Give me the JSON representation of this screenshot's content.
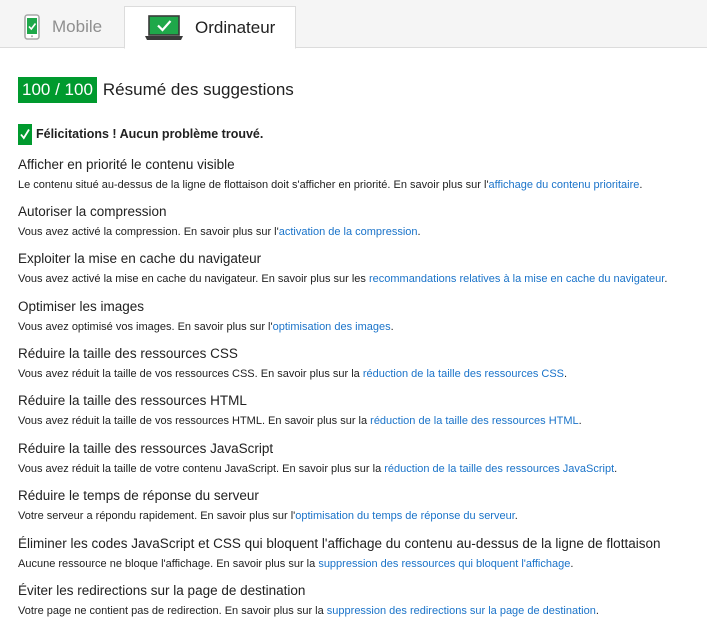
{
  "tabs": [
    {
      "label": "Mobile",
      "icon": "smartphone-icon",
      "active": false
    },
    {
      "label": "Ordinateur",
      "icon": "laptop-icon",
      "active": true
    }
  ],
  "score": {
    "value": "100 / 100",
    "title": "Résumé des suggestions"
  },
  "congrats": "Félicitations ! Aucun problème trouvé.",
  "rules": [
    {
      "title": "Afficher en priorité le contenu visible",
      "pre": "Le contenu situé au-dessus de la ligne de flottaison doit s'afficher en priorité. En savoir plus sur l'",
      "link": "affichage du contenu prioritaire",
      "post": "."
    },
    {
      "title": "Autoriser la compression",
      "pre": "Vous avez activé la compression. En savoir plus sur l'",
      "link": "activation de la compression",
      "post": "."
    },
    {
      "title": "Exploiter la mise en cache du navigateur",
      "pre": "Vous avez activé la mise en cache du navigateur. En savoir plus sur les ",
      "link": "recommandations relatives à la mise en cache du navigateur",
      "post": "."
    },
    {
      "title": "Optimiser les images",
      "pre": "Vous avez optimisé vos images. En savoir plus sur l'",
      "link": "optimisation des images",
      "post": "."
    },
    {
      "title": "Réduire la taille des ressources CSS",
      "pre": "Vous avez réduit la taille de vos ressources CSS. En savoir plus sur la ",
      "link": "réduction de la taille des ressources CSS",
      "post": "."
    },
    {
      "title": "Réduire la taille des ressources HTML",
      "pre": "Vous avez réduit la taille de vos ressources HTML. En savoir plus sur la ",
      "link": "réduction de la taille des ressources HTML",
      "post": "."
    },
    {
      "title": "Réduire la taille des ressources JavaScript",
      "pre": "Vous avez réduit la taille de votre contenu JavaScript. En savoir plus sur la ",
      "link": "réduction de la taille des ressources JavaScript",
      "post": "."
    },
    {
      "title": "Réduire le temps de réponse du serveur",
      "pre": "Votre serveur a répondu rapidement. En savoir plus sur l'",
      "link": "optimisation du temps de réponse du serveur",
      "post": "."
    },
    {
      "title": "Éliminer les codes JavaScript et CSS qui bloquent l'affichage du contenu au-dessus de la ligne de flottaison",
      "pre": "Aucune ressource ne bloque l'affichage. En savoir plus sur la ",
      "link": "suppression des ressources qui bloquent l'affichage",
      "post": "."
    },
    {
      "title": "Éviter les redirections sur la page de destination",
      "pre": "Votre page ne contient pas de redirection. En savoir plus sur la ",
      "link": "suppression des redirections sur la page de destination",
      "post": "."
    }
  ],
  "colors": {
    "accent": "#009a2e",
    "link": "#1a73c9"
  }
}
